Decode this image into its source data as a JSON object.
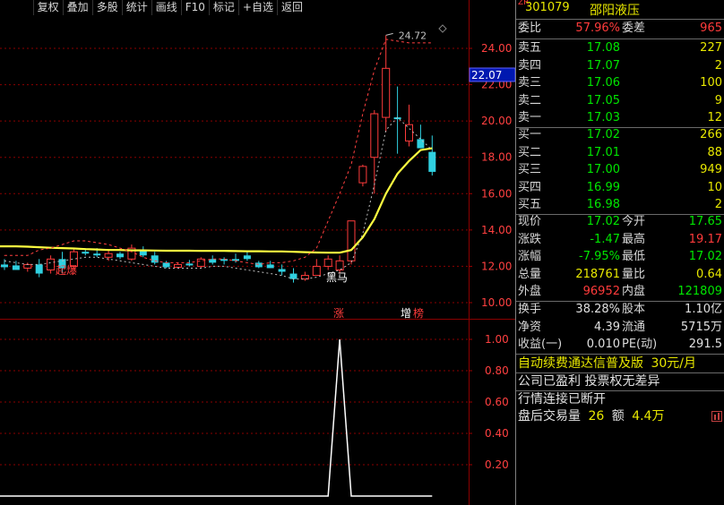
{
  "toolbar": {
    "buttons": [
      "复权",
      "叠加",
      "多股",
      "统计",
      "画线",
      "F10",
      "标记",
      "+自选",
      "返回"
    ]
  },
  "chart": {
    "price_axis_labels": [
      "24.00",
      "22.00",
      "20.00",
      "18.00",
      "16.00",
      "14.00",
      "12.00",
      "10.00"
    ],
    "price_axis_values": [
      24,
      22,
      20,
      18,
      16,
      14,
      12,
      10
    ],
    "current_price_tag": "22.07",
    "high_annotation": "24.72",
    "signal_labels": {
      "left": "起爆",
      "mid": "黑马",
      "zhang": "涨",
      "zeng": "增",
      "bang": "榜"
    },
    "indicator_axis_labels": [
      "1.00",
      "0.80",
      "0.60",
      "0.40",
      "0.20"
    ],
    "indicator_axis_values": [
      1.0,
      0.8,
      0.6,
      0.4,
      0.2
    ],
    "colors": {
      "up": "#ff3b3b",
      "down": "#30d0e0",
      "ma": "#ffff40",
      "grid": "#8b0000"
    },
    "candles": [
      {
        "o": 12.1,
        "h": 12.4,
        "l": 11.8,
        "c": 11.95,
        "up": false
      },
      {
        "o": 12.05,
        "h": 12.3,
        "l": 11.9,
        "c": 11.8,
        "up": false
      },
      {
        "o": 11.9,
        "h": 12.2,
        "l": 11.7,
        "c": 12.1,
        "up": true
      },
      {
        "o": 12.1,
        "h": 12.4,
        "l": 11.4,
        "c": 11.6,
        "up": false
      },
      {
        "o": 11.8,
        "h": 12.6,
        "l": 11.6,
        "c": 12.4,
        "up": true
      },
      {
        "o": 12.4,
        "h": 12.8,
        "l": 11.6,
        "c": 11.9,
        "up": false
      },
      {
        "o": 12.0,
        "h": 13.0,
        "l": 11.8,
        "c": 12.8,
        "up": true
      },
      {
        "o": 12.8,
        "h": 13.0,
        "l": 12.6,
        "c": 12.7,
        "up": false
      },
      {
        "o": 12.7,
        "h": 13.0,
        "l": 12.5,
        "c": 12.6,
        "up": false
      },
      {
        "o": 12.5,
        "h": 12.9,
        "l": 12.3,
        "c": 12.7,
        "up": true
      },
      {
        "o": 12.7,
        "h": 12.8,
        "l": 12.4,
        "c": 12.5,
        "up": false
      },
      {
        "o": 12.4,
        "h": 13.2,
        "l": 12.3,
        "c": 13.0,
        "up": true
      },
      {
        "o": 12.9,
        "h": 13.1,
        "l": 12.5,
        "c": 12.6,
        "up": false
      },
      {
        "o": 12.6,
        "h": 12.8,
        "l": 12.1,
        "c": 12.2,
        "up": false
      },
      {
        "o": 12.2,
        "h": 12.3,
        "l": 11.9,
        "c": 11.95,
        "up": false
      },
      {
        "o": 11.95,
        "h": 12.2,
        "l": 11.9,
        "c": 12.1,
        "up": true
      },
      {
        "o": 12.15,
        "h": 12.35,
        "l": 12.0,
        "c": 12.05,
        "up": false
      },
      {
        "o": 12.0,
        "h": 12.5,
        "l": 11.9,
        "c": 12.4,
        "up": true
      },
      {
        "o": 12.4,
        "h": 12.6,
        "l": 12.1,
        "c": 12.2,
        "up": false
      },
      {
        "o": 12.3,
        "h": 12.5,
        "l": 12.1,
        "c": 12.4,
        "up": false
      },
      {
        "o": 12.4,
        "h": 12.7,
        "l": 12.2,
        "c": 12.3,
        "up": false
      },
      {
        "o": 12.6,
        "h": 12.8,
        "l": 12.3,
        "c": 12.4,
        "up": false
      },
      {
        "o": 12.2,
        "h": 12.3,
        "l": 11.9,
        "c": 11.95,
        "up": false
      },
      {
        "o": 12.1,
        "h": 12.3,
        "l": 11.9,
        "c": 11.9,
        "up": false
      },
      {
        "o": 11.85,
        "h": 12.1,
        "l": 11.5,
        "c": 11.7,
        "up": false
      },
      {
        "o": 11.6,
        "h": 11.9,
        "l": 11.1,
        "c": 11.3,
        "up": false
      },
      {
        "o": 11.3,
        "h": 11.7,
        "l": 11.2,
        "c": 11.5,
        "up": true
      },
      {
        "o": 11.5,
        "h": 12.4,
        "l": 11.5,
        "c": 12.0,
        "up": true
      },
      {
        "o": 12.0,
        "h": 12.6,
        "l": 11.8,
        "c": 12.4,
        "up": true
      },
      {
        "o": 11.8,
        "h": 12.6,
        "l": 11.6,
        "c": 12.3,
        "up": true
      },
      {
        "o": 12.3,
        "h": 14.5,
        "l": 12.1,
        "c": 14.5,
        "up": true
      },
      {
        "o": 16.6,
        "h": 17.6,
        "l": 16.4,
        "c": 17.5,
        "up": true
      },
      {
        "o": 18.0,
        "h": 20.6,
        "l": 16.0,
        "c": 20.4,
        "up": true
      },
      {
        "o": 20.2,
        "h": 24.72,
        "l": 19.4,
        "c": 22.9,
        "up": true
      },
      {
        "o": 20.2,
        "h": 21.9,
        "l": 18.2,
        "c": 20.1,
        "up": false
      },
      {
        "o": 19.8,
        "h": 20.9,
        "l": 18.6,
        "c": 18.9,
        "up": true
      },
      {
        "o": 19.0,
        "h": 19.8,
        "l": 18.5,
        "c": 18.5,
        "up": false
      },
      {
        "o": 18.3,
        "h": 19.2,
        "l": 17.0,
        "c": 17.2,
        "up": false
      }
    ],
    "ma_line": [
      13.1,
      13.1,
      13.08,
      13.05,
      13.02,
      13.0,
      12.98,
      12.95,
      12.93,
      12.9,
      12.9,
      12.88,
      12.88,
      12.87,
      12.86,
      12.86,
      12.86,
      12.85,
      12.85,
      12.85,
      12.84,
      12.83,
      12.83,
      12.82,
      12.82,
      12.8,
      12.78,
      12.76,
      12.75,
      12.75,
      12.9,
      13.6,
      14.6,
      16.0,
      17.1,
      17.8,
      18.4,
      18.5
    ],
    "indicator_values": [
      0,
      0,
      0,
      0,
      0,
      0,
      0,
      0,
      0,
      0,
      0,
      0,
      0,
      0,
      0,
      0,
      0,
      0,
      0,
      0,
      0,
      0,
      0,
      0,
      0,
      0,
      0,
      0,
      0,
      1,
      0,
      0,
      0,
      0,
      0,
      0,
      0,
      0
    ]
  },
  "quote": {
    "zr_tag": "ZR",
    "code": "301079",
    "name": "邵阳液压",
    "weibi_label": "委比",
    "weibi_value": "57.96%",
    "weicha_label": "委差",
    "weicha_value": "965",
    "asks": [
      {
        "label": "卖五",
        "price": "17.08",
        "vol": "227"
      },
      {
        "label": "卖四",
        "price": "17.07",
        "vol": "2"
      },
      {
        "label": "卖三",
        "price": "17.06",
        "vol": "100"
      },
      {
        "label": "卖二",
        "price": "17.05",
        "vol": "9"
      },
      {
        "label": "卖一",
        "price": "17.03",
        "vol": "12"
      }
    ],
    "bids": [
      {
        "label": "买一",
        "price": "17.02",
        "vol": "266"
      },
      {
        "label": "买二",
        "price": "17.01",
        "vol": "88"
      },
      {
        "label": "买三",
        "price": "17.00",
        "vol": "949"
      },
      {
        "label": "买四",
        "price": "16.99",
        "vol": "10"
      },
      {
        "label": "买五",
        "price": "16.98",
        "vol": "2"
      }
    ],
    "stats": [
      {
        "l1": "现价",
        "v1": "17.02",
        "c1": "green",
        "l2": "今开",
        "v2": "17.65",
        "c2": "green"
      },
      {
        "l1": "涨跌",
        "v1": "-1.47",
        "c1": "green",
        "l2": "最高",
        "v2": "19.17",
        "c2": "red"
      },
      {
        "l1": "涨幅",
        "v1": "-7.95%",
        "c1": "green",
        "l2": "最低",
        "v2": "17.02",
        "c2": "green"
      },
      {
        "l1": "总量",
        "v1": "218761",
        "c1": "yellow",
        "l2": "量比",
        "v2": "0.64",
        "c2": "yellow"
      },
      {
        "l1": "外盘",
        "v1": "96952",
        "c1": "red",
        "l2": "内盘",
        "v2": "121809",
        "c2": "green"
      }
    ],
    "fund": [
      {
        "l1": "换手",
        "v1": "38.28%",
        "l2": "股本",
        "v2": "1.10亿"
      },
      {
        "l1": "净资",
        "v1": "4.39",
        "l2": "流通",
        "v2": "5715万"
      },
      {
        "l1": "收益(一)",
        "v1": "0.010",
        "l2": "PE(动)",
        "v2": "291.5"
      }
    ],
    "notice_main": "自动续费通达信普及版",
    "notice_price": "30元/月",
    "line2": "公司已盈利 投票权无差异",
    "line3": "行情连接已断开",
    "line4_a": "盘后交易量",
    "line4_b": "26",
    "line4_c": "额",
    "line4_d": "4.4万"
  }
}
